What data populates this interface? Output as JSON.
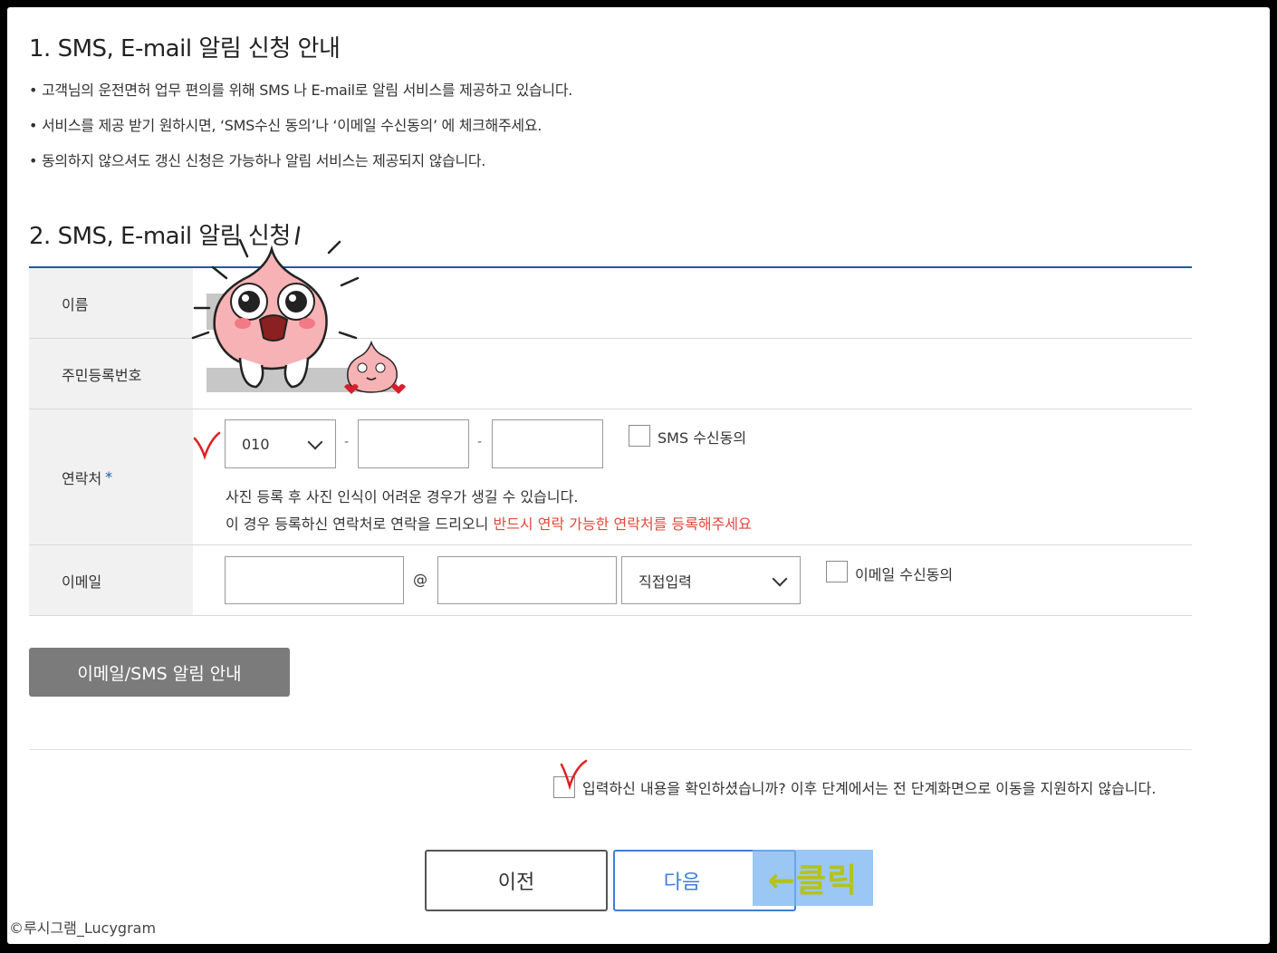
{
  "section1": {
    "title": "1. SMS, E-mail 알림 신청 안내",
    "bullets": [
      "고객님의 운전면허 업무 편의를 위해 SMS 나 E-mail로 알림 서비스를 제공하고 있습니다.",
      "서비스를 제공 받기 원하시면, ‘SMS수신 동의’나 ‘이메일 수신동의’ 에 체크해주세요.",
      "동의하지 않으셔도 갱신 신청은 가능하나 알림 서비스는 제공되지 않습니다."
    ]
  },
  "section2": {
    "title": "2. SMS, E-mail 알림 신청"
  },
  "form": {
    "name_label": "이름",
    "rrn_label": "주민등록번호",
    "phone_label": "연락처",
    "required_mark": "*",
    "phone_prefix": "010",
    "phone_sep": "-",
    "sms_consent_label": "SMS 수신동의",
    "note_line1": "사진 등록 후 사진 인식이 어려운 경우가 생길 수 있습니다.",
    "note_line2_prefix": "이 경우 등록하신 연락처로 연락을 드리오니 ",
    "note_line2_highlight": "반드시 연락 가능한 연락처를 등록해주세요",
    "email_label": "이메일",
    "email_at": "@",
    "email_domain_select": "직접입력",
    "email_consent_label": "이메일 수신동의"
  },
  "email_sms_guide_button": "이메일/SMS 알림 안내",
  "confirm_text": "입력하신 내용을 확인하셨습니까? 이후 단계에서는 전 단계화면으로 이동을 지원하지 않습니다.",
  "buttons": {
    "prev": "이전",
    "next": "다음"
  },
  "annotation": {
    "click_label": "←클릭"
  },
  "watermark": "©루시그램_Lucygram",
  "colors": {
    "accent_blue": "#1e5aa8",
    "next_blue": "#3e7fd6",
    "warning_red": "#e4483b",
    "guide_button_gray": "#7b7b7b",
    "click_tag_text": "#b5c21a"
  }
}
